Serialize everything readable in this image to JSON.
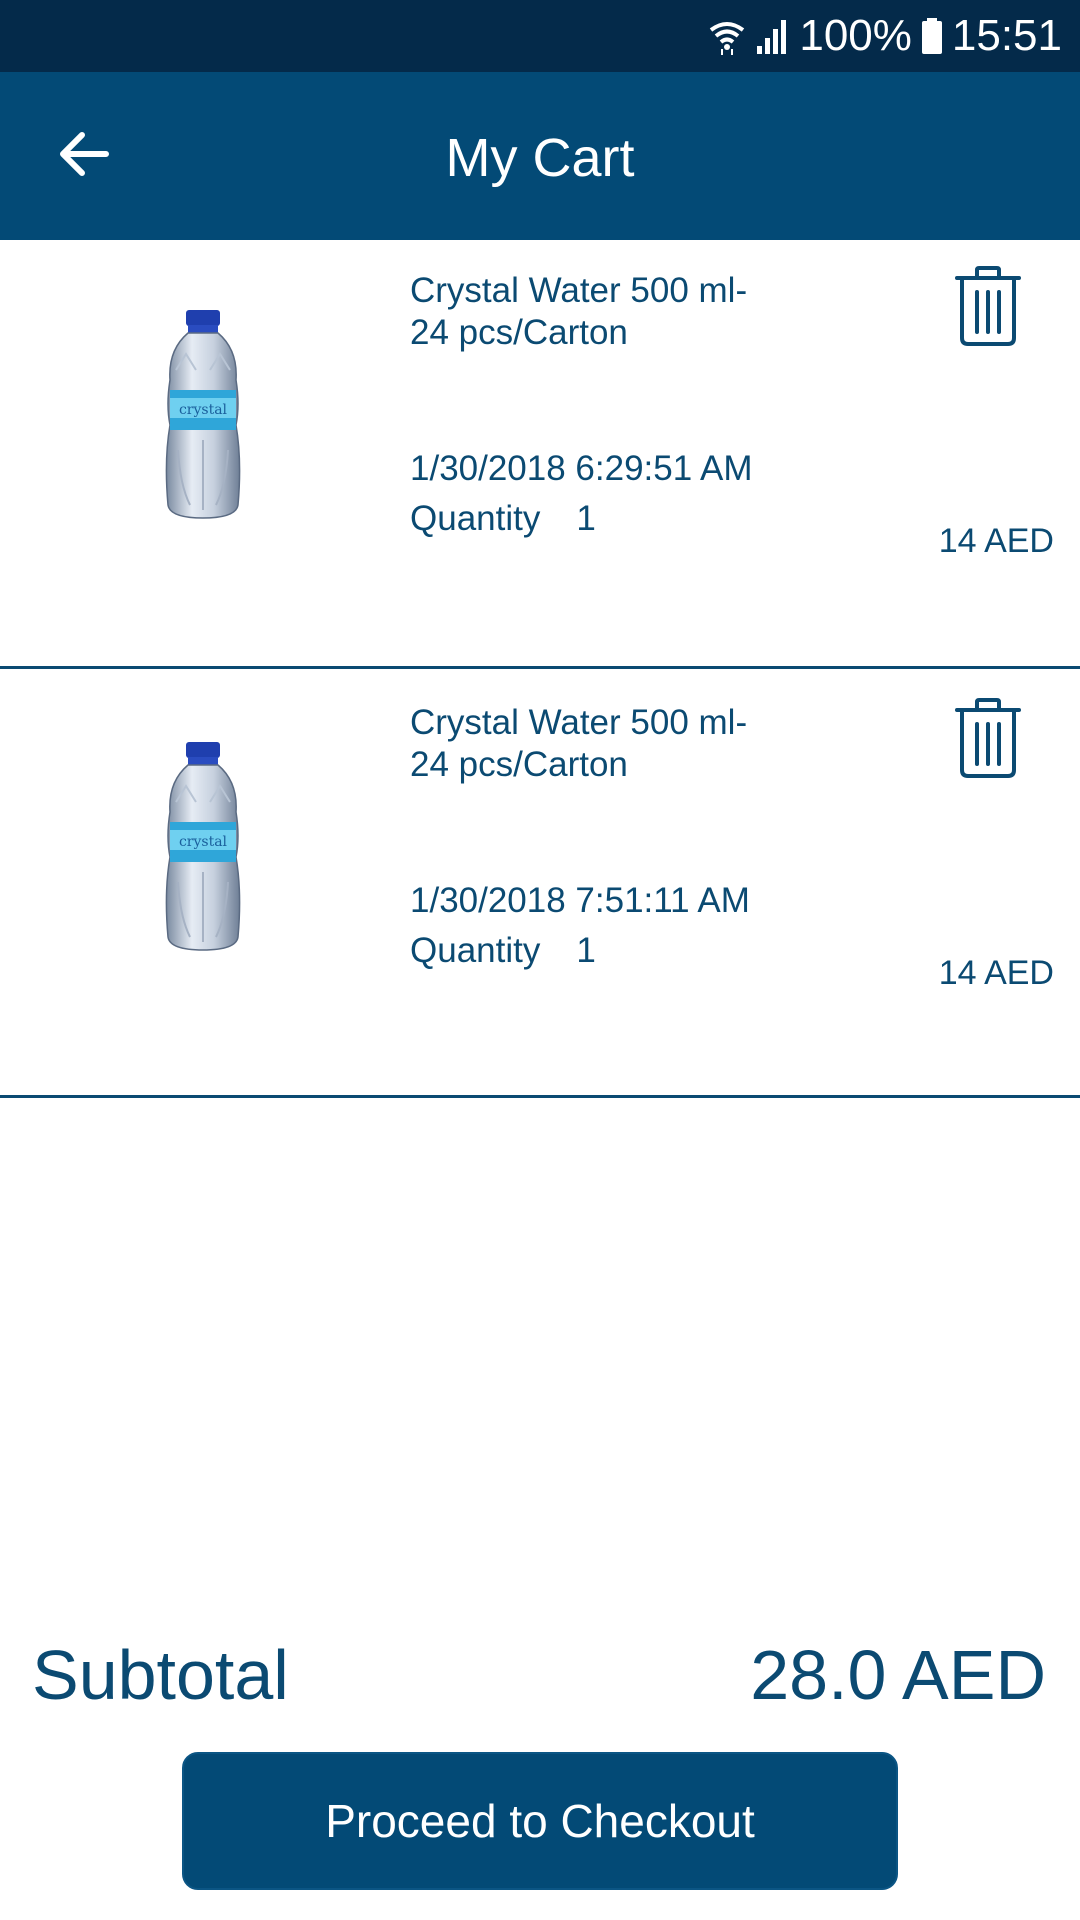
{
  "status_bar": {
    "battery": "100%",
    "time": "15:51",
    "icons": [
      "wifi-icon",
      "signal-icon",
      "battery-icon"
    ]
  },
  "app_bar": {
    "title": "My Cart",
    "back_icon": "arrow-back-icon"
  },
  "cart": {
    "items": [
      {
        "name": "Crystal Water 500 ml-24 pcs/Carton",
        "date": "1/30/2018 6:29:51 AM",
        "quantity_label": "Quantity",
        "quantity": "1",
        "price": "14 AED",
        "image_icon": "water-bottle-image",
        "delete_icon": "trash-icon"
      },
      {
        "name": "Crystal Water 500 ml-24 pcs/Carton",
        "date": "1/30/2018 7:51:11 AM",
        "quantity_label": "Quantity",
        "quantity": "1",
        "price": "14 AED",
        "image_icon": "water-bottle-image",
        "delete_icon": "trash-icon"
      }
    ]
  },
  "summary": {
    "subtotal_label": "Subtotal",
    "subtotal_value": "28.0 AED"
  },
  "checkout": {
    "label": "Proceed to Checkout"
  },
  "colors": {
    "status_bar": "#042a4a",
    "app_bar": "#034a76",
    "text": "#0b4a72",
    "background": "#ffffff"
  }
}
